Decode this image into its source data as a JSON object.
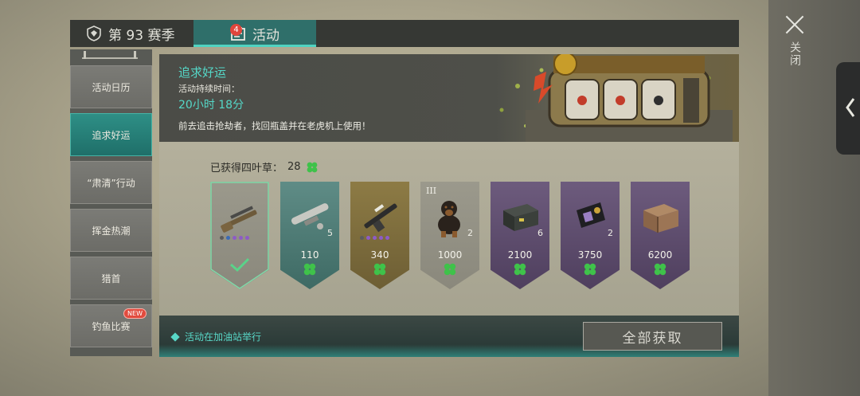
{
  "tabs": {
    "season_label": "第 93 赛季",
    "activity_label": "活动",
    "activity_badge": "4"
  },
  "close": {
    "label": "关闭"
  },
  "menu": {
    "items": [
      {
        "label": "活动日历"
      },
      {
        "label": "追求好运"
      },
      {
        "label": "“肃清”行动"
      },
      {
        "label": "挥金热潮"
      },
      {
        "label": "猎首"
      },
      {
        "label": "钓鱼比赛"
      }
    ],
    "new_badge": "NEW"
  },
  "event": {
    "title": "追求好运",
    "duration_label": "活动持续时间：",
    "duration_value": "20小时 18分",
    "description": "前去追击抢劫者，找回瓶盖并在老虎机上使用！"
  },
  "rewards": {
    "clover_label": "已获得四叶草：",
    "clover_count": "28",
    "items": [
      {
        "name": "shotgun",
        "cost": "",
        "qty": "",
        "tier": "",
        "claimed": true
      },
      {
        "name": "rocket-launcher",
        "cost": "110",
        "qty": "5",
        "tier": ""
      },
      {
        "name": "assault-rifle",
        "cost": "340",
        "qty": "",
        "tier": ""
      },
      {
        "name": "dog",
        "cost": "1000",
        "qty": "2",
        "tier": "III"
      },
      {
        "name": "weapon-crate",
        "cost": "2100",
        "qty": "6",
        "tier": ""
      },
      {
        "name": "badge-wallet",
        "cost": "3750",
        "qty": "2",
        "tier": ""
      },
      {
        "name": "wooden-crate",
        "cost": "6200",
        "qty": "",
        "tier": ""
      }
    ]
  },
  "footer": {
    "note": "活动在加油站举行",
    "claim_all_label": "全部获取"
  },
  "colors": {
    "accent": "#55d8c8",
    "tab_active": "#2f6f6a",
    "badge_red": "#e0463c"
  }
}
